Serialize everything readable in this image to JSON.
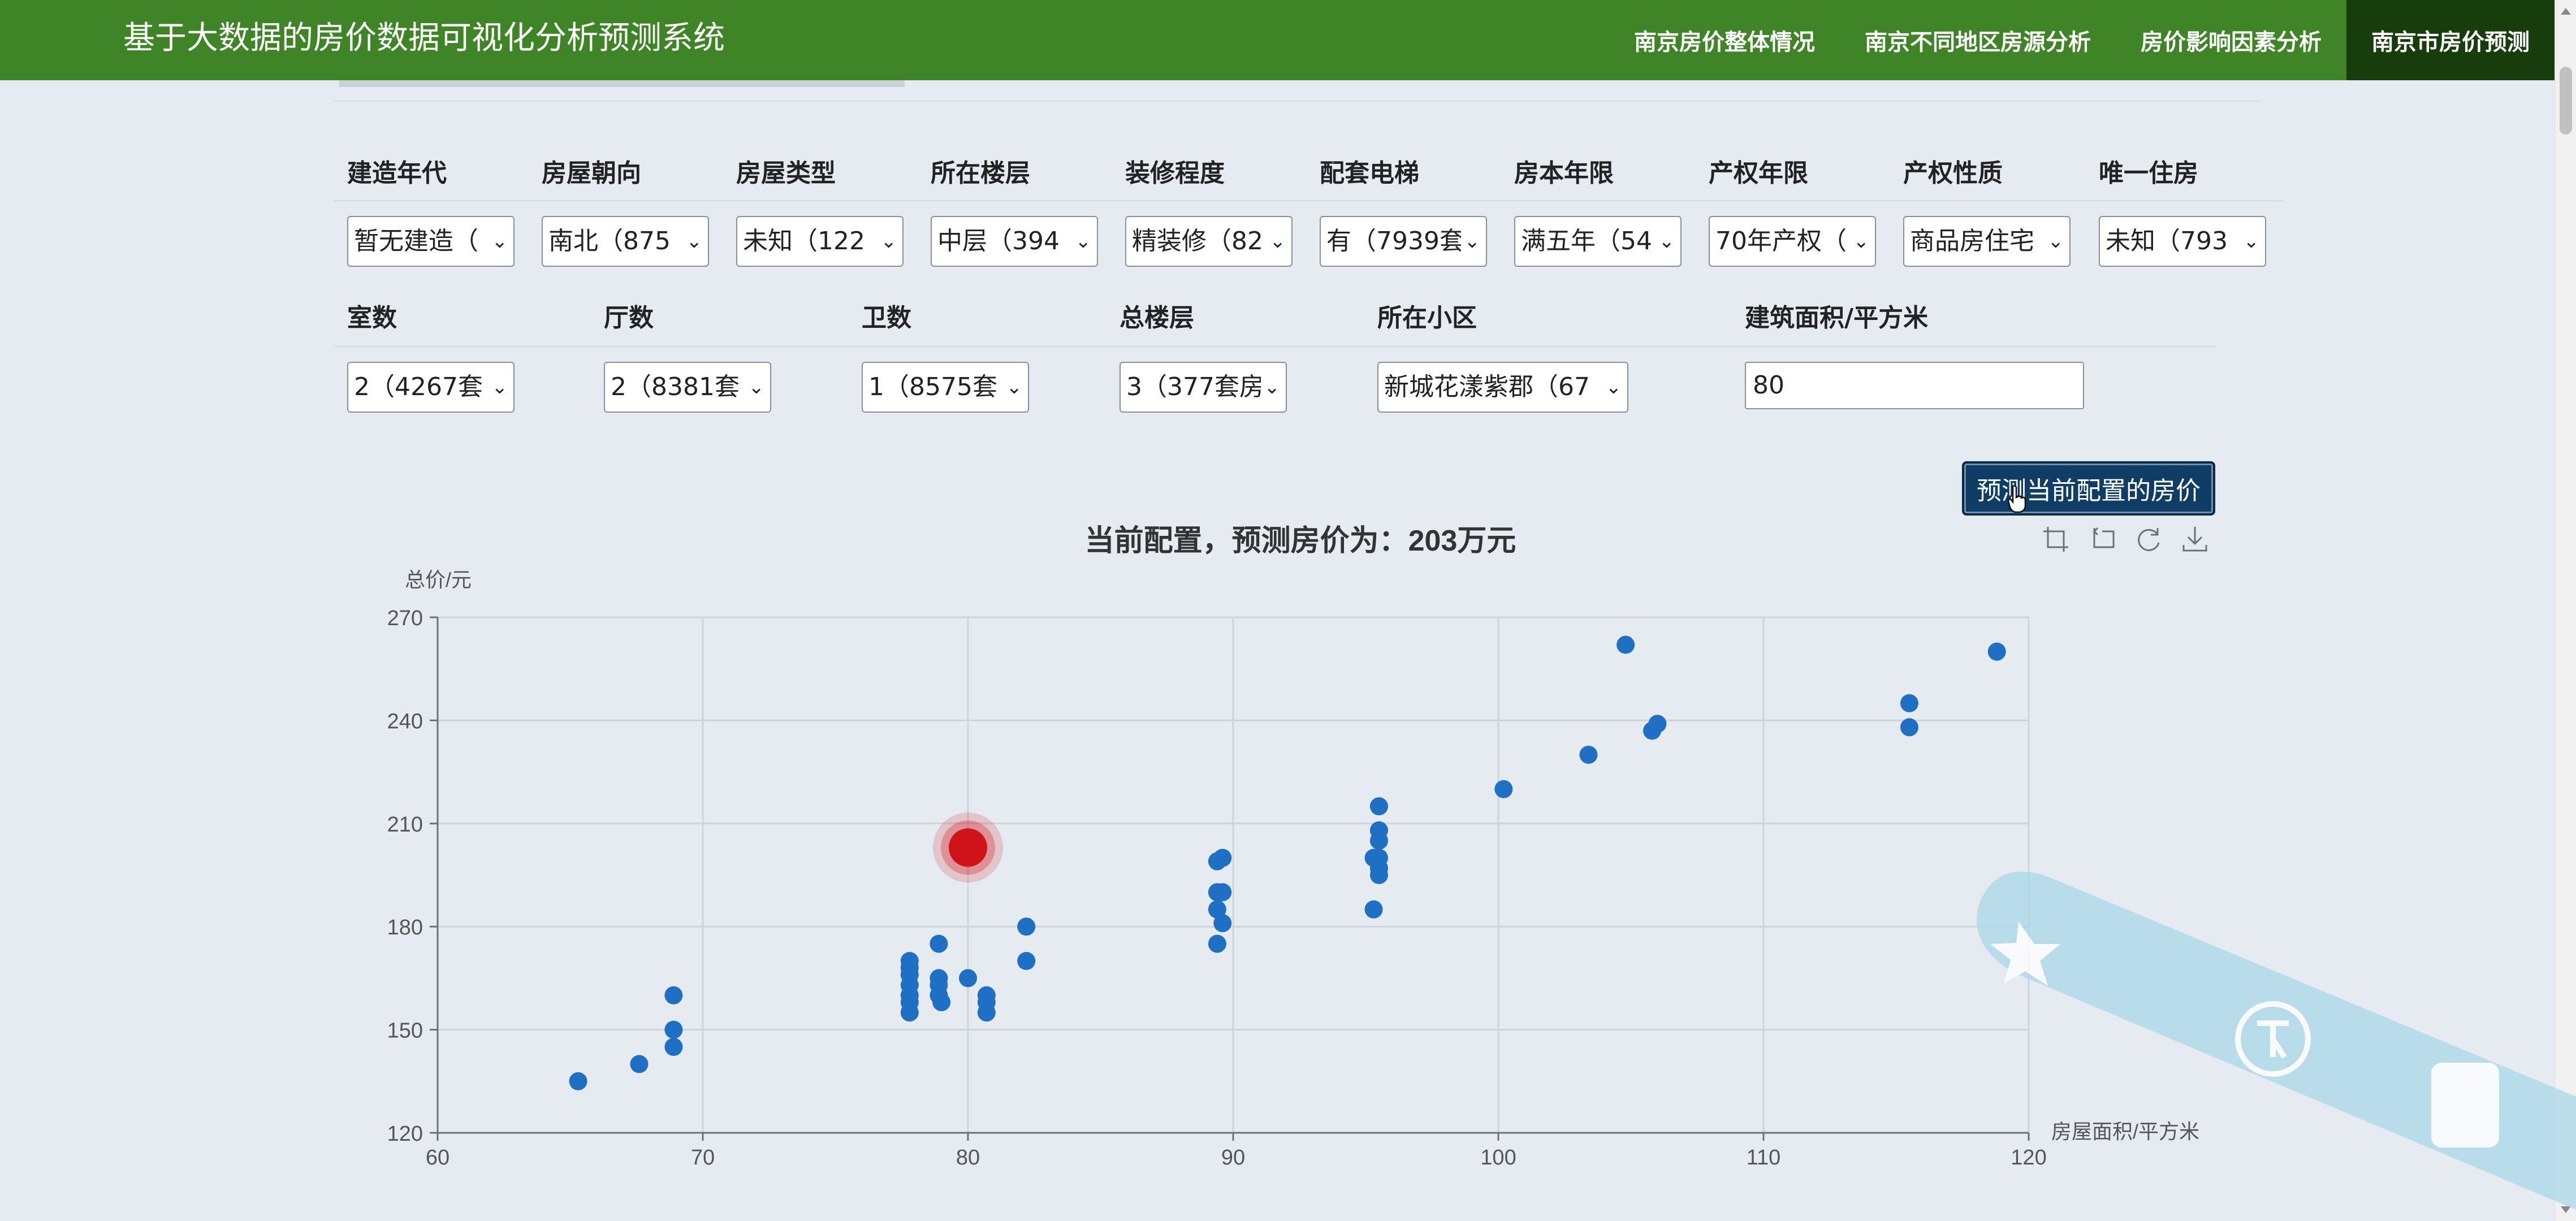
{
  "app": {
    "title": "基于大数据的房价数据可视化分析预测系统",
    "nav": [
      {
        "label": "南京房价整体情况",
        "active": false
      },
      {
        "label": "南京不同地区房源分析",
        "active": false
      },
      {
        "label": "房价影响因素分析",
        "active": false
      },
      {
        "label": "南京市房价预测",
        "active": true
      }
    ],
    "colors": {
      "navbar": "#3f8427",
      "nav_active": "#173d0c",
      "point": "#1f6fc5",
      "highlight": "#d0161b"
    }
  },
  "form": {
    "row1": [
      {
        "label": "建造年代",
        "value": "暂无建造（"
      },
      {
        "label": "房屋朝向",
        "value": "南北（875"
      },
      {
        "label": "房屋类型",
        "value": "未知（122"
      },
      {
        "label": "所在楼层",
        "value": "中层（394"
      },
      {
        "label": "装修程度",
        "value": "精装修（82"
      },
      {
        "label": "配套电梯",
        "value": "有（7939套"
      },
      {
        "label": "房本年限",
        "value": "满五年（54"
      },
      {
        "label": "产权年限",
        "value": "70年产权（"
      },
      {
        "label": "产权性质",
        "value": "商品房住宅"
      },
      {
        "label": "唯一住房",
        "value": "未知（793"
      }
    ],
    "row2": [
      {
        "label": "室数",
        "value": "2（4267套"
      },
      {
        "label": "厅数",
        "value": "2（8381套"
      },
      {
        "label": "卫数",
        "value": "1（8575套"
      },
      {
        "label": "总楼层",
        "value": "3（377套房"
      },
      {
        "label": "所在小区",
        "value": "新城花漾紫郡（67"
      }
    ],
    "area": {
      "label": "建筑面积/平方米",
      "value": "80"
    },
    "predict_button": "预测当前配置的房价"
  },
  "toolbox": {
    "icons": [
      "zoom-icon",
      "zoom-reset-icon",
      "restore-icon",
      "download-icon"
    ]
  },
  "chart_data": {
    "type": "scatter",
    "title": "当前配置，预测房价为：203万元",
    "xlabel": "房屋面积/平方米",
    "ylabel": "总价/元",
    "xlim": [
      60,
      120
    ],
    "ylim": [
      120,
      270
    ],
    "xticks": [
      "60",
      "70",
      "80",
      "90",
      "100",
      "110",
      "120"
    ],
    "yticks": [
      "120",
      "150",
      "180",
      "210",
      "240",
      "270"
    ],
    "grid": true,
    "series": [
      {
        "points": [
          [
            65.3,
            135
          ],
          [
            67.6,
            140
          ],
          [
            68.9,
            160
          ],
          [
            68.9,
            150
          ],
          [
            68.9,
            145
          ],
          [
            77.8,
            170
          ],
          [
            77.8,
            168
          ],
          [
            77.8,
            166
          ],
          [
            77.8,
            163
          ],
          [
            77.8,
            160
          ],
          [
            77.8,
            158
          ],
          [
            77.8,
            155
          ],
          [
            78.9,
            175
          ],
          [
            78.9,
            165
          ],
          [
            78.9,
            163
          ],
          [
            78.9,
            160
          ],
          [
            79.0,
            158
          ],
          [
            80.0,
            165
          ],
          [
            80.7,
            160
          ],
          [
            80.7,
            158
          ],
          [
            80.7,
            155
          ],
          [
            82.2,
            180
          ],
          [
            82.2,
            170
          ],
          [
            89.4,
            199
          ],
          [
            89.4,
            190
          ],
          [
            89.4,
            185
          ],
          [
            89.4,
            175
          ],
          [
            89.6,
            200
          ],
          [
            89.6,
            190
          ],
          [
            89.6,
            181
          ],
          [
            95.3,
            200
          ],
          [
            95.3,
            185
          ],
          [
            95.5,
            215
          ],
          [
            95.5,
            208
          ],
          [
            95.5,
            205
          ],
          [
            95.5,
            200
          ],
          [
            95.5,
            197
          ],
          [
            95.5,
            195
          ],
          [
            100.2,
            220
          ],
          [
            103.4,
            230
          ],
          [
            104.8,
            262
          ],
          [
            105.8,
            237
          ],
          [
            106.0,
            239
          ],
          [
            115.5,
            245
          ],
          [
            115.5,
            238
          ],
          [
            118.8,
            260
          ]
        ]
      },
      {
        "highlight": true,
        "points": [
          [
            80,
            203
          ]
        ]
      }
    ]
  }
}
